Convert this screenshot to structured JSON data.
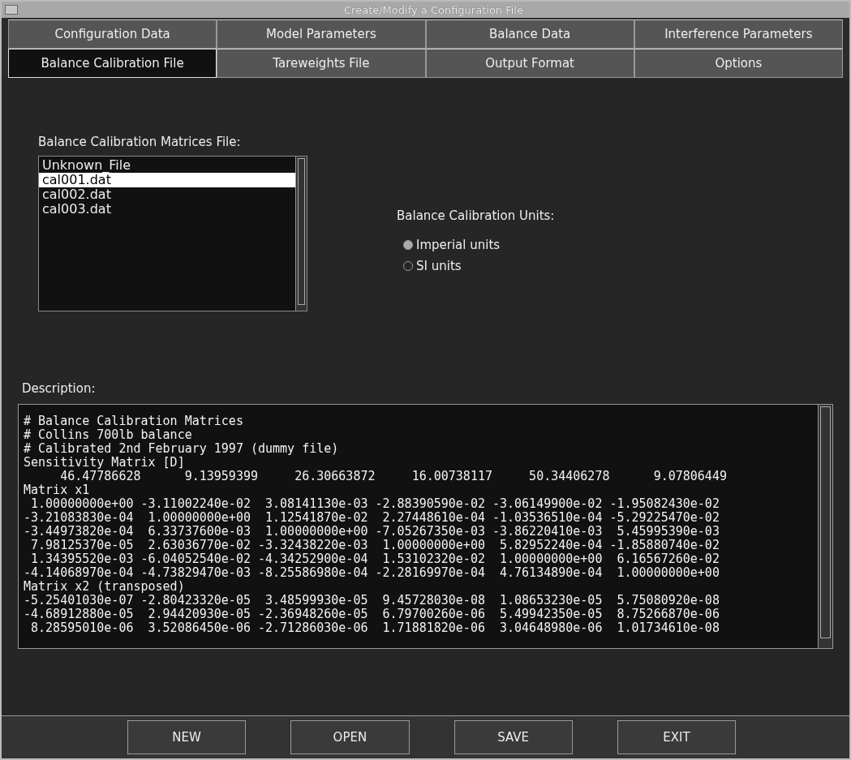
{
  "window": {
    "title": "Create/Modify a Configuration File"
  },
  "tab_rows": [
    [
      {
        "label": "Configuration Data",
        "selected": false
      },
      {
        "label": "Model Parameters",
        "selected": false
      },
      {
        "label": "Balance Data",
        "selected": false
      },
      {
        "label": "Interference Parameters",
        "selected": false
      }
    ],
    [
      {
        "label": "Balance Calibration File",
        "selected": true
      },
      {
        "label": "Tareweights File",
        "selected": false
      },
      {
        "label": "Output Format",
        "selected": false
      },
      {
        "label": "Options",
        "selected": false
      }
    ]
  ],
  "file_list": {
    "label": "Balance Calibration Matrices File:",
    "items": [
      {
        "label": "Unknown_File",
        "selected": false
      },
      {
        "label": "cal001.dat",
        "selected": true
      },
      {
        "label": "cal002.dat",
        "selected": false
      },
      {
        "label": "cal003.dat",
        "selected": false
      }
    ]
  },
  "units": {
    "label": "Balance Calibration Units:",
    "options": [
      {
        "label": "Imperial units",
        "selected": true
      },
      {
        "label": "SI units",
        "selected": false
      }
    ]
  },
  "description": {
    "label": "Description:",
    "lines": [
      "# Balance Calibration Matrices",
      "# Collins 700lb balance",
      "# Calibrated 2nd February 1997 (dummy file)",
      "Sensitivity Matrix [D]",
      "     46.47786628      9.13959399     26.30663872     16.00738117     50.34406278      9.07806449",
      "Matrix x1",
      " 1.00000000e+00 -3.11002240e-02  3.08141130e-03 -2.88390590e-02 -3.06149900e-02 -1.95082430e-02",
      "-3.21083830e-04  1.00000000e+00  1.12541870e-02  2.27448610e-04 -1.03536510e-04 -5.29225470e-02",
      "-3.44973820e-04  6.33737600e-03  1.00000000e+00 -7.05267350e-03 -3.86220410e-03  5.45995390e-03",
      " 7.98125370e-05  2.63036770e-02 -3.32438220e-03  1.00000000e+00  5.82952240e-04 -1.85880740e-02",
      " 1.34395520e-03 -6.04052540e-02 -4.34252900e-04  1.53102320e-02  1.00000000e+00  6.16567260e-02",
      "-4.14068970e-04 -4.73829470e-03 -8.25586980e-04 -2.28169970e-04  4.76134890e-04  1.00000000e+00",
      "Matrix x2 (transposed)",
      "-5.25401030e-07 -2.80423320e-05  3.48599930e-05  9.45728030e-08  1.08653230e-05  5.75080920e-08",
      "-4.68912880e-05  2.94420930e-05 -2.36948260e-05  6.79700260e-06  5.49942350e-05  8.75266870e-06",
      " 8.28595010e-06  3.52086450e-06 -2.71286030e-06  1.71881820e-06  3.04648980e-06  1.01734610e-08"
    ]
  },
  "buttons": [
    "NEW",
    "OPEN",
    "SAVE",
    "EXIT"
  ]
}
